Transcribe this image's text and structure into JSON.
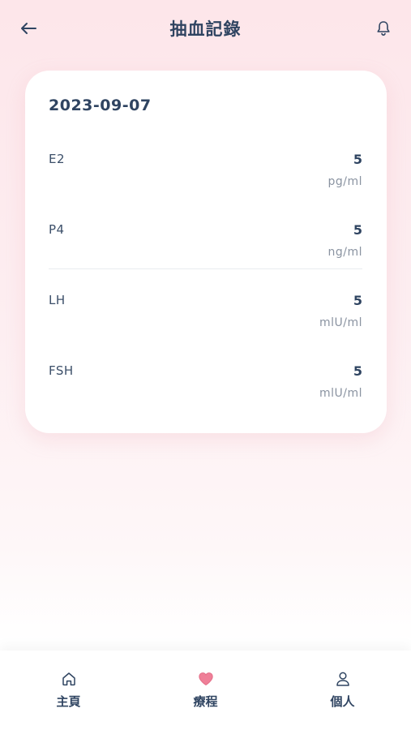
{
  "header": {
    "title": "抽血記錄",
    "back_icon": "arrow-left-icon",
    "bell_icon": "bell-icon"
  },
  "record": {
    "date": "2023-09-07",
    "items": [
      {
        "label": "E2",
        "value": "5",
        "unit": "pg/ml"
      },
      {
        "label": "P4",
        "value": "5",
        "unit": "ng/ml"
      },
      {
        "label": "LH",
        "value": "5",
        "unit": "mlU/ml"
      },
      {
        "label": "FSH",
        "value": "5",
        "unit": "mlU/ml"
      }
    ]
  },
  "nav": {
    "items": [
      {
        "label": "主頁",
        "icon": "home-icon"
      },
      {
        "label": "療程",
        "icon": "heart-icon"
      },
      {
        "label": "個人",
        "icon": "user-icon"
      }
    ]
  },
  "colors": {
    "primary_text": "#2f4461",
    "muted_text": "#8a93a1",
    "accent_pink": "#ef7f98",
    "bg_pink": "#fde6ea"
  }
}
